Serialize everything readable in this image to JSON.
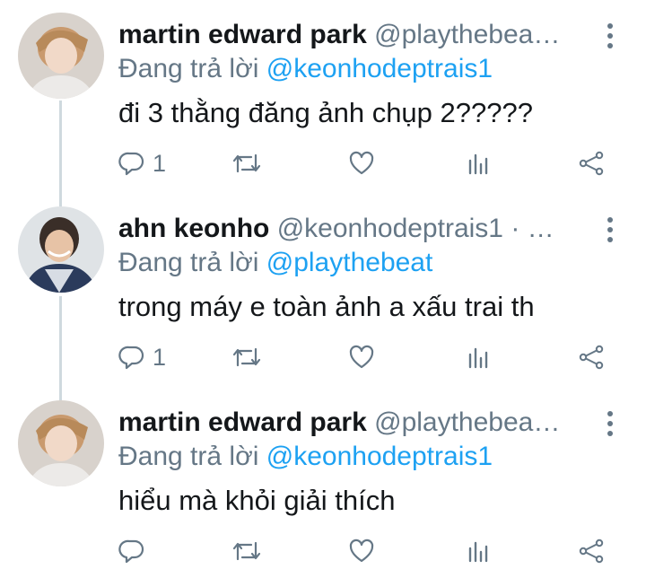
{
  "tweets": [
    {
      "name": "martin edward park",
      "handle": "@playthebea…",
      "reply_prefix": "Đang trả lời ",
      "reply_to": "@keonhodeptrais1",
      "text": "đi 3 thằng đăng ảnh chụp 2?????",
      "reply_count": "1",
      "retweet_count": "",
      "like_count": ""
    },
    {
      "name": "ahn keonho",
      "handle": "@keonhodeptrais1 · …",
      "reply_prefix": "Đang trả lời ",
      "reply_to": "@playthebeat",
      "text": "trong máy e toàn ảnh a xấu trai th",
      "reply_count": "1",
      "retweet_count": "",
      "like_count": ""
    },
    {
      "name": "martin edward park",
      "handle": "@playthebea…",
      "reply_prefix": "Đang trả lời ",
      "reply_to": "@keonhodeptrais1",
      "text": "hiểu mà khỏi giải thích",
      "reply_count": "",
      "retweet_count": "",
      "like_count": ""
    }
  ],
  "colors": {
    "text": "#14171a",
    "secondary": "#657786",
    "mention": "#1da1f2",
    "thread_line": "#cfd9de"
  },
  "icons": [
    "reply-icon",
    "retweet-icon",
    "like-icon",
    "analytics-icon",
    "share-icon",
    "more-menu-icon"
  ]
}
